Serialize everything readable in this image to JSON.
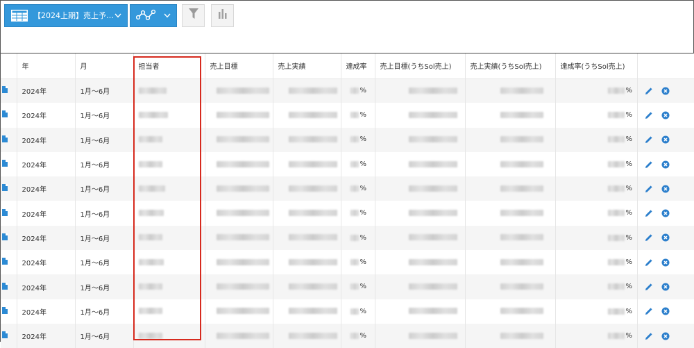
{
  "toolbar": {
    "view_label": "【2024上期】売上予…",
    "view_icon": "table-icon",
    "graph_icon": "line-graph-icon",
    "filter_icon": "filter-icon",
    "chart_icon": "bar-chart-icon",
    "accent_color": "#3498db"
  },
  "table": {
    "headers": [
      "年",
      "月",
      "担当者",
      "売上目標",
      "売上実績",
      "達成率",
      "売上目標(うちSol売上)",
      "売上実績(うちSol売上)",
      "達成率(うちSol売上)"
    ],
    "rows": [
      {
        "year": "2024年",
        "month": "1月～6月",
        "pct1": "%",
        "pct2": "%"
      },
      {
        "year": "2024年",
        "month": "1月～6月",
        "pct1": "%",
        "pct2": "%"
      },
      {
        "year": "2024年",
        "month": "1月～6月",
        "pct1": "%",
        "pct2": "%"
      },
      {
        "year": "2024年",
        "month": "1月～6月",
        "pct1": "%",
        "pct2": "%"
      },
      {
        "year": "2024年",
        "month": "1月～6月",
        "pct1": "%",
        "pct2": "%"
      },
      {
        "year": "2024年",
        "month": "1月～6月",
        "pct1": "%",
        "pct2": "%"
      },
      {
        "year": "2024年",
        "month": "1月～6月",
        "pct1": "%",
        "pct2": "%"
      },
      {
        "year": "2024年",
        "month": "1月～6月",
        "pct1": "%",
        "pct2": "%"
      },
      {
        "year": "2024年",
        "month": "1月～6月",
        "pct1": "%",
        "pct2": "%"
      },
      {
        "year": "2024年",
        "month": "1月～6月",
        "pct1": "%",
        "pct2": "%"
      },
      {
        "year": "2024年",
        "month": "1月～6月",
        "pct1": "%",
        "pct2": "%"
      }
    ],
    "row_icons": {
      "record": "document-icon",
      "edit": "pencil-icon",
      "delete": "delete-circle-icon"
    },
    "highlight_color": "#d62a1e"
  }
}
